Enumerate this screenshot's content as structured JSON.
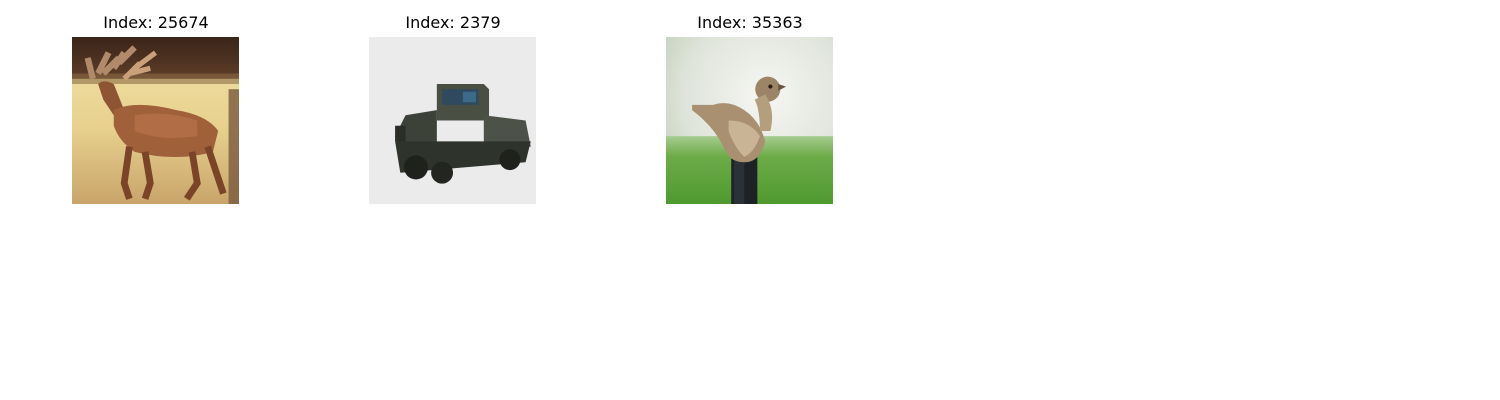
{
  "panels": [
    {
      "title": "Index: 25674",
      "image": "deer-photo"
    },
    {
      "title": "Index: 2379",
      "image": "truck-photo"
    },
    {
      "title": "Index: 35363",
      "image": "bird-photo"
    }
  ]
}
